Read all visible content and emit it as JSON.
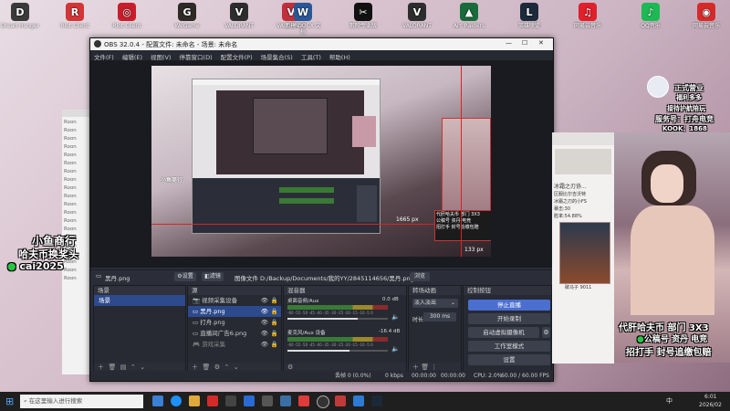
{
  "desktop_icons": [
    {
      "label": "Dread Hunger",
      "color": "#3a3a3a",
      "glyph": "D"
    },
    {
      "label": "Riot Client",
      "color": "#d13639",
      "glyph": "R"
    },
    {
      "label": "Riot Client",
      "color": "#c81e2c",
      "glyph": "◎"
    },
    {
      "label": "WeGame",
      "color": "#2e2a26",
      "glyph": "G"
    },
    {
      "label": "VALORANT",
      "color": "#2d2d2d",
      "glyph": "V"
    },
    {
      "label": "VALORANT",
      "color": "#c0303c",
      "glyph": "V"
    },
    {
      "label": "新建 DOCX 文档",
      "color": "#2b5797",
      "glyph": "W"
    },
    {
      "label": "剪映专业版",
      "color": "#111111",
      "glyph": "✂"
    },
    {
      "label": "VALORANT",
      "color": "#2d2d2d",
      "glyph": "V"
    },
    {
      "label": "Arc Raiders",
      "color": "#1a6b3b",
      "glyph": "▲"
    },
    {
      "label": "英雄联盟",
      "color": "#1c2a3a",
      "glyph": "L"
    },
    {
      "label": "网易云音乐",
      "color": "#e0202b",
      "glyph": "♫"
    },
    {
      "label": "QQ音乐",
      "color": "#1db954",
      "glyph": "♪"
    },
    {
      "label": "网易云音乐",
      "color": "#d62a2a",
      "glyph": "◉"
    }
  ],
  "obs": {
    "title": "OBS 32.0.4 - 配置文件: 未命名 - 场景: 未命名",
    "menu": [
      "文件(F)",
      "编辑(E)",
      "视图(V)",
      "停靠窗口(D)",
      "配置文件(P)",
      "场景集合(S)",
      "工具(T)",
      "帮助(H)"
    ],
    "preview_labels": {
      "resolution": "1665 px",
      "offset": "133 px"
    },
    "source_bar": {
      "name": "黑丹.png",
      "properties": "设置",
      "filters": "滤镜",
      "file_label": "图像文件",
      "path": "D:/Backup/Documents/我的YY/2845114656/黑丹.png",
      "browse": "浏览"
    },
    "scenes": {
      "title": "场景",
      "items": [
        "场景"
      ]
    },
    "sources": {
      "title": "源",
      "items": [
        "视频采集设备",
        "黑丹.png",
        "打舟.png",
        "直播间广告6.png",
        "游戏采集"
      ]
    },
    "mixer": {
      "title": "混音器",
      "channels": [
        {
          "name": "桌面音频/Aux",
          "db": "0.0 dB"
        },
        {
          "name": "麦克风/Aux 设备",
          "db": "-16.4 dB"
        }
      ],
      "scale": "-60 -55 -50 -45 -40 -35 -30 -25 -20 -15 -10 -5 0"
    },
    "transitions": {
      "title": "转场动画",
      "type": "淡入淡出",
      "duration_label": "时长",
      "duration_value": "300 ms"
    },
    "controls": {
      "title": "控制按钮",
      "buttons": [
        "停止直播",
        "开始录制",
        "启动虚拟摄像机",
        "工作室模式",
        "设置"
      ]
    },
    "status": {
      "dropped": "丢帧 0 (0.0%)",
      "bitrate": "0 kbps",
      "time1": "00:00:00",
      "time2": "00:00:00",
      "cpu": "CPU: 2.0%",
      "fps": "60.00 / 60.00 FPS"
    }
  },
  "overlay_text": {
    "left_title": "小鱼商行",
    "left_line2": "哈夫币换奖头",
    "left_wechat": "cai2025",
    "right_badge1": "正式营业",
    "right_badge2": "福利多多",
    "right_badge3": "接待护航陪玩",
    "right_service": "服务号：打舟电竞",
    "right_kook": "KOOK：1868",
    "right_ad1": "代肝哈夫币 部门 3X3",
    "right_ad2": "公稿号 资丹 电竞",
    "right_ad3": "招打手 封号追缴包赔",
    "card_caption": "破马子 9011"
  },
  "chat": {
    "lines": [
      "冰霜之刃协...",
      "区服比尔吉沃特",
      "冰霜之刃的小FS",
      "暴击:30",
      "胜率:54.88%"
    ]
  },
  "taskbar": {
    "search_placeholder": "在这里输入进行搜索",
    "time": "6:01",
    "date": "2026/02",
    "lang": "中"
  }
}
